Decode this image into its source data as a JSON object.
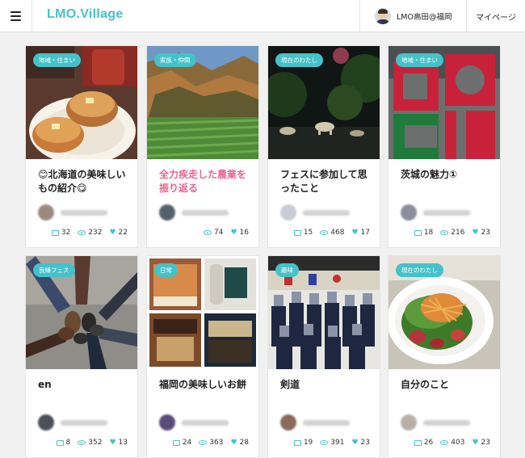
{
  "header": {
    "logo": "LMO.Village",
    "user_name": "LMO高田@福岡",
    "mypage_label": "マイページ"
  },
  "colors": {
    "accent": "#45c2c9",
    "pink": "#e8668e"
  },
  "icons": {
    "menu": "hamburger-menu-icon",
    "comment": "comment-icon",
    "views": "eye-icon",
    "likes": "heart-icon"
  },
  "cards": [
    {
      "tag": "地域・住まい",
      "title": "😊北海道の美味しいもの紹介😋",
      "comments": "32",
      "views": "232",
      "likes": "22"
    },
    {
      "tag": "家族・仲間",
      "title": "全力疾走した農業を振り返る",
      "comments": "",
      "views": "74",
      "likes": "16"
    },
    {
      "tag": "現在のわたし",
      "title": "フェスに参加して思ったこと",
      "comments": "15",
      "views": "468",
      "likes": "17"
    },
    {
      "tag": "地域・住まい",
      "title": "茨城の魅力①",
      "comments": "18",
      "views": "216",
      "likes": "23"
    },
    {
      "tag": "良縁フェス",
      "title": "en",
      "comments": "8",
      "views": "352",
      "likes": "13"
    },
    {
      "tag": "日常",
      "title": "福岡の美味しいお餅",
      "comments": "24",
      "views": "363",
      "likes": "28"
    },
    {
      "tag": "趣味",
      "title": "剣道",
      "comments": "19",
      "views": "391",
      "likes": "23"
    },
    {
      "tag": "現在のわたし",
      "title": "自分のこと",
      "comments": "26",
      "views": "403",
      "likes": "23"
    }
  ]
}
